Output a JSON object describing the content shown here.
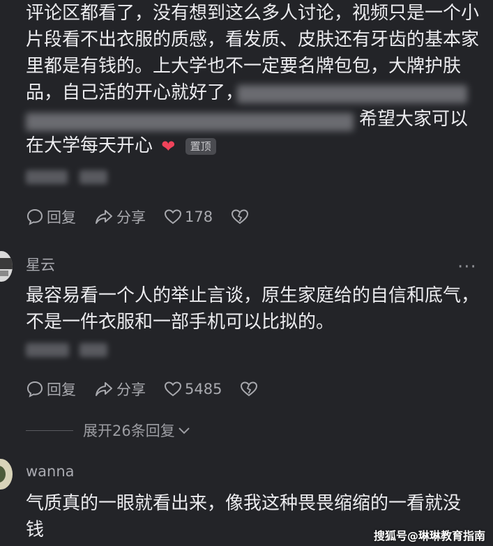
{
  "comment1": {
    "lines": [
      "评论区都看了，没有想到这么多人讨论，视频只是一个小",
      "片段看不出衣服的质感，看发质、皮肤还有牙齿的基本家",
      "里都是有钱的。上大学也不一定要名牌包包，大牌护肤",
      "品，自己活的开心就好了，",
      "",
      "在大学每天开心"
    ],
    "line5_tail": "希望大家可以",
    "pin_label": "置顶",
    "reply_label": "回复",
    "share_label": "分享",
    "like_count": "178"
  },
  "comment2": {
    "username": "星云",
    "lines": [
      "最容易看一个人的举止言谈，原生家庭给的自信和底气，",
      "不是一件衣服和一部手机可以比拟的。"
    ],
    "reply_label": "回复",
    "share_label": "分享",
    "like_count": "5485",
    "more": "···"
  },
  "expand_replies": "展开26条回复",
  "comment3": {
    "username": "wanna",
    "lines": [
      "气质真的一眼就看出来，像我这种畏畏缩缩的一看就没",
      "钱"
    ]
  },
  "watermark": "搜狐号@琳琳教育指南",
  "colors": {
    "background": "#232428",
    "like_red": "#f0435a"
  }
}
